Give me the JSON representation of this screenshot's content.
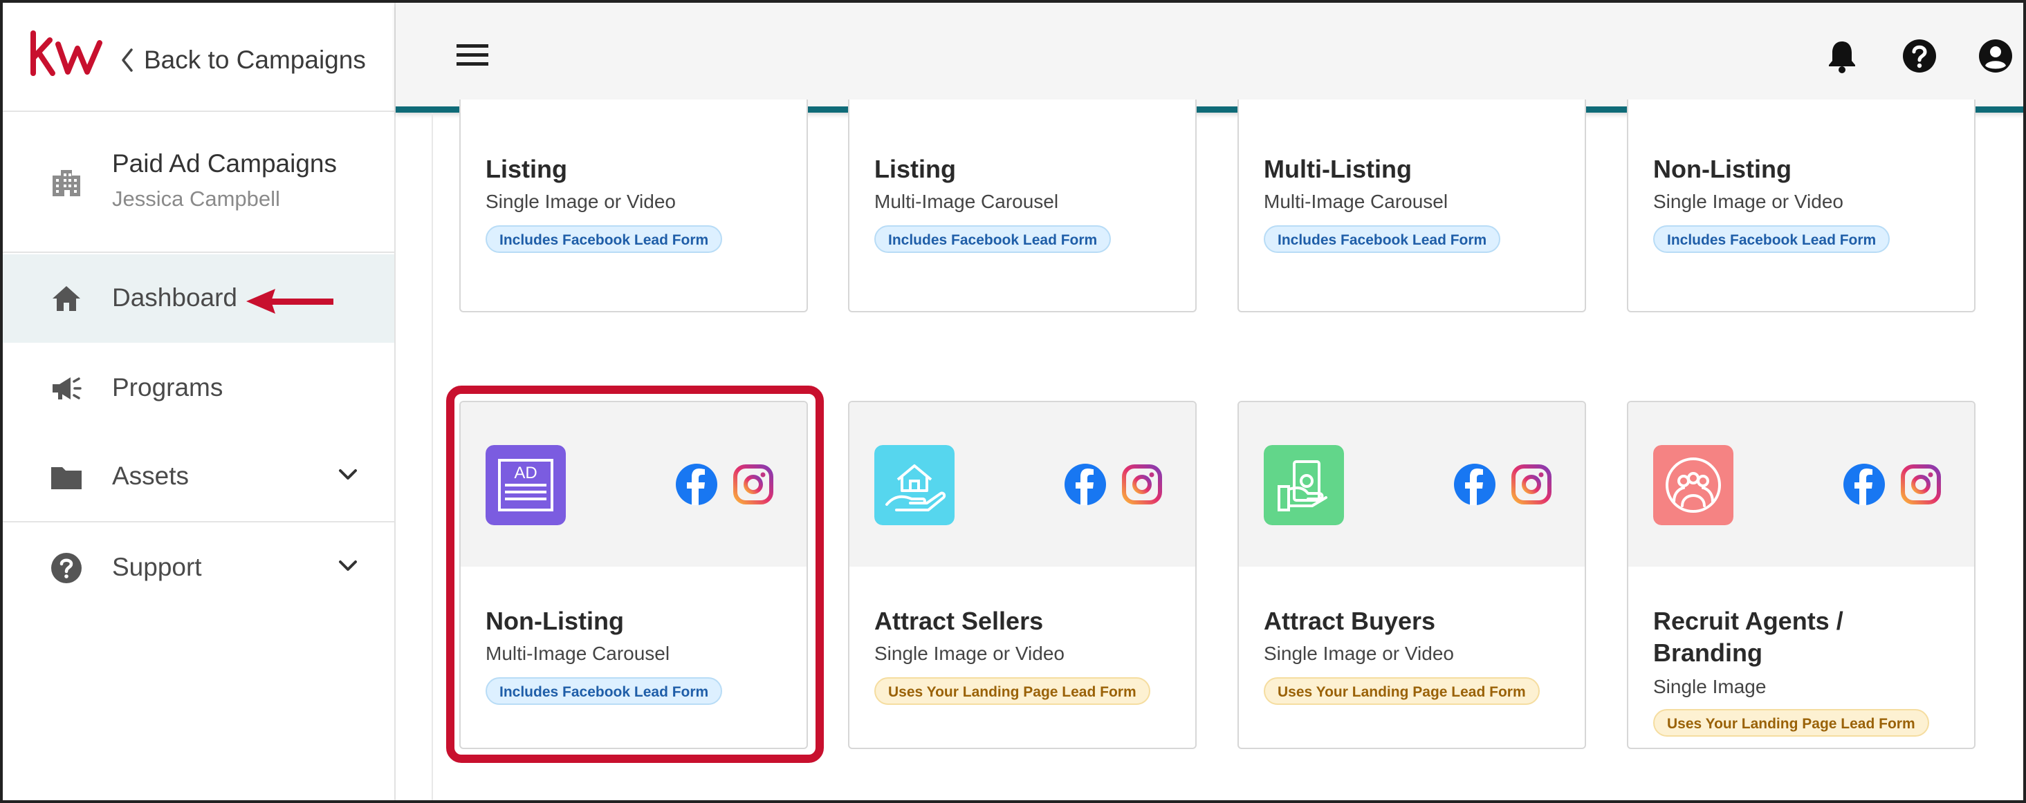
{
  "sidebar": {
    "back_label": "Back to Campaigns",
    "campaign_title": "Paid Ad Campaigns",
    "campaign_owner": "Jessica Campbell",
    "nav": [
      {
        "label": "Dashboard",
        "icon": "home-icon",
        "active": true
      },
      {
        "label": "Programs",
        "icon": "megaphone-icon"
      },
      {
        "label": "Assets",
        "icon": "folder-icon",
        "expandable": true
      },
      {
        "label": "Support",
        "icon": "help-circle-icon",
        "expandable": true
      }
    ]
  },
  "header": {
    "icons": [
      "menu-icon",
      "bell-icon",
      "help-icon",
      "account-icon"
    ]
  },
  "cards_top": [
    {
      "title": "Listing",
      "subtitle": "Single Image or Video",
      "badge": "Includes Facebook Lead Form"
    },
    {
      "title": "Listing",
      "subtitle": "Multi-Image Carousel",
      "badge": "Includes Facebook Lead Form"
    },
    {
      "title": "Multi-Listing",
      "subtitle": "Multi-Image Carousel",
      "badge": "Includes Facebook Lead Form"
    },
    {
      "title": "Non-Listing",
      "subtitle": "Single Image or Video",
      "badge": "Includes Facebook Lead Form"
    }
  ],
  "cards_bottom": [
    {
      "title": "Non-Listing",
      "subtitle": "Multi-Image Carousel",
      "badge": "Includes Facebook Lead Form",
      "icon_text": "AD",
      "icon_color": "#7b5ce0"
    },
    {
      "title": "Attract Sellers",
      "subtitle": "Single Image or Video",
      "badge": "Uses Your Landing Page Lead Form",
      "icon_color": "#56d6ee"
    },
    {
      "title": "Attract Buyers",
      "subtitle": "Single Image or Video",
      "badge": "Uses Your Landing Page Lead Form",
      "icon_color": "#62d68a"
    },
    {
      "title_line1": "Recruit Agents /",
      "title_line2": "Branding",
      "subtitle": "Single Image",
      "badge": "Uses Your Landing Page Lead Form",
      "icon_color": "#f58383"
    }
  ],
  "colors": {
    "brand_red": "#c8102e",
    "header_accent": "#0f6b78",
    "facebook_blue": "#1877f2",
    "active_nav_bg": "#ebf2f3"
  }
}
